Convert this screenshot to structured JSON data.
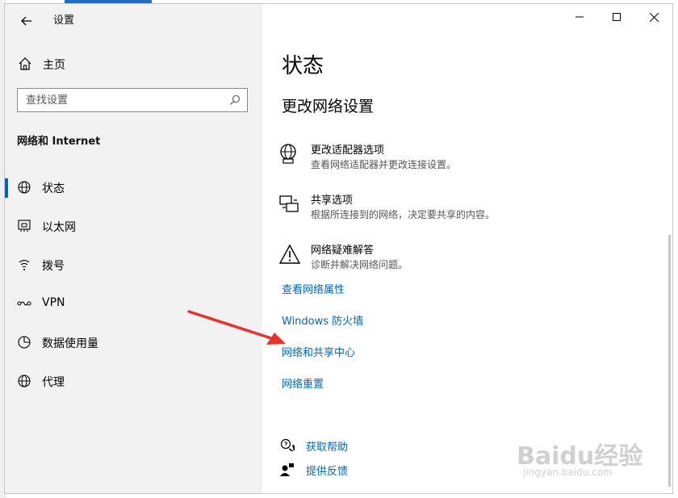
{
  "window": {
    "app_title": "设置",
    "controls": {
      "minimize": "minimize",
      "maximize": "maximize",
      "close": "close"
    }
  },
  "sidebar": {
    "home_label": "主页",
    "search_placeholder": "查找设置",
    "section_title": "网络和 Internet",
    "items": [
      {
        "label": "状态",
        "icon": "globe-icon",
        "active": true
      },
      {
        "label": "以太网",
        "icon": "ethernet-icon",
        "active": false
      },
      {
        "label": "拨号",
        "icon": "dialup-icon",
        "active": false
      },
      {
        "label": "VPN",
        "icon": "vpn-icon",
        "active": false
      },
      {
        "label": "数据使用量",
        "icon": "data-usage-icon",
        "active": false
      },
      {
        "label": "代理",
        "icon": "globe-icon",
        "active": false
      }
    ]
  },
  "main": {
    "title": "状态",
    "subtitle": "更改网络设置",
    "options": [
      {
        "title": "更改适配器选项",
        "desc": "查看网络适配器并更改连接设置。",
        "icon": "adapter-icon"
      },
      {
        "title": "共享选项",
        "desc": "根据所连接到的网络，决定要共享的内容。",
        "icon": "sharing-icon"
      },
      {
        "title": "网络疑难解答",
        "desc": "诊断并解决网络问题。",
        "icon": "warning-icon"
      }
    ],
    "links": [
      "查看网络属性",
      "Windows 防火墙",
      "网络和共享中心",
      "网络重置"
    ],
    "help": {
      "get_help": "获取帮助",
      "feedback": "提供反馈"
    }
  },
  "watermark": {
    "big": "Baidu经验",
    "small": "jingyan.baidu.com"
  },
  "colors": {
    "accent": "#0067c0",
    "link": "#0067b8",
    "arrow": "#e8322a",
    "sidebar_bg": "#f2f2f2"
  }
}
